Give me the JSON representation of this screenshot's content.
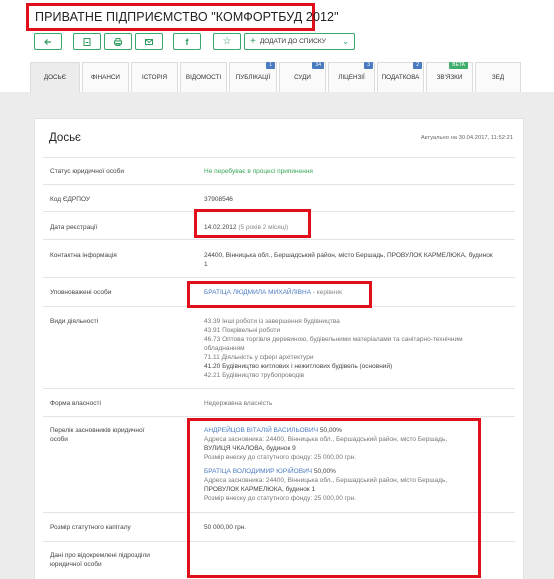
{
  "title": "ПРИВАТНЕ ПІДПРИЄМСТВО \"КОМФОРТБУД 2012\"",
  "toolbar": {
    "buttons": [
      "back-icon",
      "pdf-icon",
      "print-icon",
      "mail-icon",
      "facebook-icon",
      "star-icon"
    ],
    "add_list_label": "ДОДАТИ ДО СПИСКУ"
  },
  "tabs": [
    {
      "label": "ДОСЬЄ"
    },
    {
      "label": "ФІНАНСИ"
    },
    {
      "label": "ІСТОРІЯ"
    },
    {
      "label": "ВІДОМОСТІ"
    },
    {
      "label": "ПУБЛІКАЦІЇ",
      "count": "1"
    },
    {
      "label": "СУДИ",
      "count": "34"
    },
    {
      "label": "ЛІЦЕНЗІЇ",
      "count": "3"
    },
    {
      "label": "ПОДАТКОВА",
      "count": "2"
    },
    {
      "label": "ЗВ'ЯЗКИ",
      "badge": "beta"
    },
    {
      "label": "ЗЕД"
    }
  ],
  "dossier": {
    "heading": "Досьє",
    "updated": "Актуально на 30.04.2017, 11:52:21",
    "status_label": "Статус юридичної особи",
    "status_value": "Не перебуває в процесі припинення",
    "edrpou_label": "Код ЄДРПОУ",
    "edrpou_value": "37908546",
    "reg_label": "Дата реєстрації",
    "reg_date": "14.02.2012",
    "reg_age": "(5 років 2 місяці)",
    "contact_label": "Контактна інформація",
    "contact_line1": "24400, Вінницька обл., Бершадський район, місто Бершадь, ПРОВУЛОК КАРМЕЛЮКА, будинок",
    "contact_line2": "1",
    "auth_label": "Уповноважені особи",
    "auth_name": "БРАТІЦА ЛЮДМИЛА МИХАЙЛІВНА",
    "auth_role": " - керівник",
    "activity_label": "Види діяльності",
    "activities": [
      "43.39 Інші роботи із завершення будівництва",
      "43.91 Покрівельні роботи",
      "46.73 Оптова торгівля деревиною, будівельними матеріалами та санітарно-технічним",
      "обладнанням",
      "71.11 Діяльність у сфері архітектури",
      "41.20 Будівництво житлових і нежитлових будівель (основний)",
      "42.21 Будівництво трубопроводів"
    ],
    "ownership_label": "Форма власності",
    "ownership_value": "Недержавна власність",
    "founders_label_1": "Перелік засновників юридичної",
    "founders_label_2": "особи",
    "founders": [
      {
        "name": "АНДРЕЙЦОВ ВІТАЛІЙ ВАСИЛЬОВИЧ",
        "share": " 50,00%",
        "addr1": "Адреса засновника: 24400, Вінницька обл., Бершадський район, місто Бершадь,",
        "addr2": "ВУЛИЦЯ ЧКАЛОВА, будинок 9",
        "capital": "Розмір внеску до статутного фонду: 25 000,00 грн."
      },
      {
        "name": "БРАТІЦА ВОЛОДИМИР ЮРІЙОВИЧ",
        "share": " 50,00%",
        "addr1": "Адреса засновника: 24400, Вінницька обл., Бершадський район, місто Бершадь,",
        "addr2": "ПРОВУЛОК КАРМЕЛЮКА, будинок 1",
        "capital": "Розмір внеску до статутного фонду: 25 000,00 грн."
      }
    ],
    "capital_label": "Розмір статутного капіталу",
    "capital_value": "50 000,00 грн.",
    "branches_label_1": "Дані про відокремлені підрозділи",
    "branches_label_2": "юридичної особи"
  }
}
